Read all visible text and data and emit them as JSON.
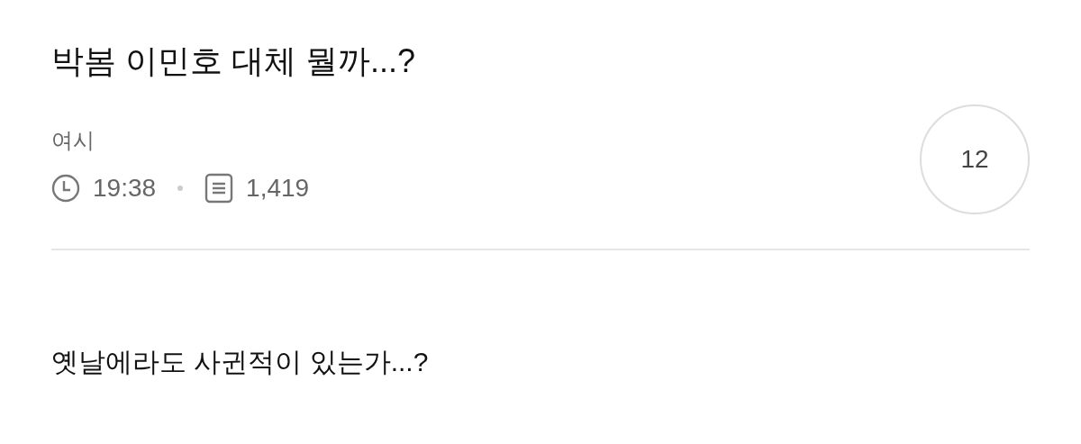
{
  "post": {
    "title": "박봄 이민호 대체 뭘까...?",
    "author": "여시",
    "time": "19:38",
    "views": "1,419",
    "comment_count": "12"
  },
  "body": {
    "text": "옛날에라도 사귄적이 있는가...?"
  }
}
